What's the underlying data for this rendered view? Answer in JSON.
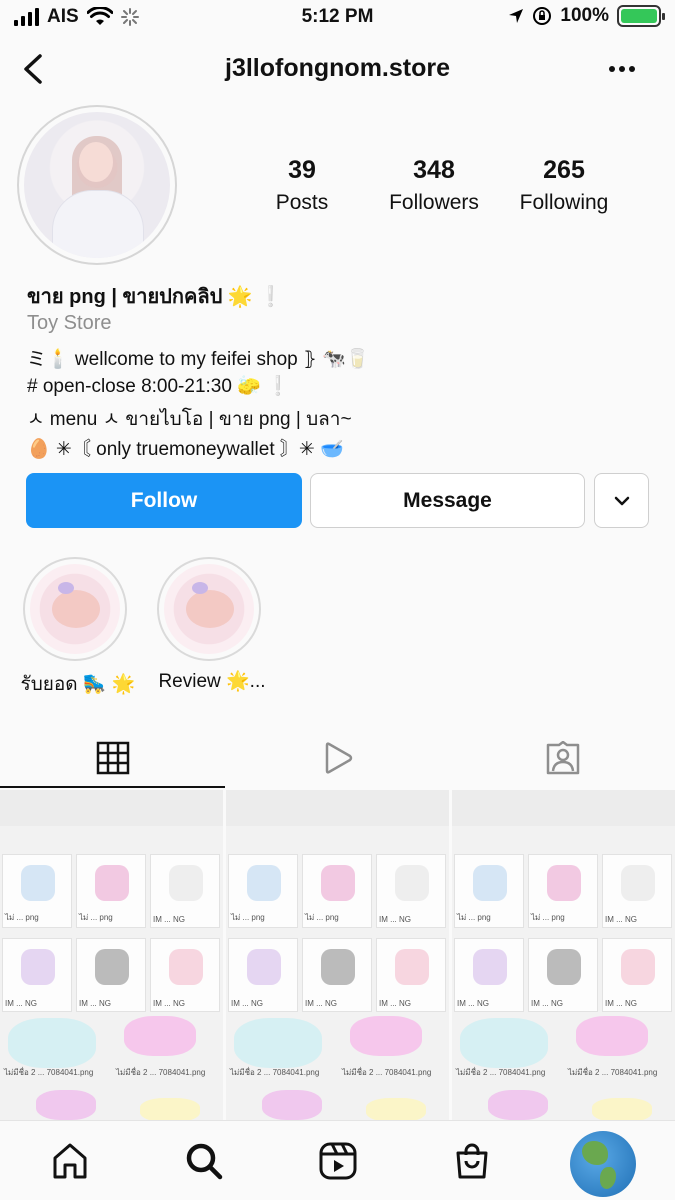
{
  "status_bar": {
    "carrier": "AIS",
    "time": "5:12 PM",
    "battery": "100%",
    "icons": [
      "signal-icon",
      "wifi-icon",
      "loading-icon",
      "location-icon",
      "orientation-lock-icon",
      "battery-charging-icon"
    ]
  },
  "header": {
    "username": "j3llofongnom.store",
    "back_icon": "chevron-left-icon",
    "more_icon": "more-dots-icon"
  },
  "profile": {
    "stats": [
      {
        "value": "39",
        "label": "Posts"
      },
      {
        "value": "348",
        "label": "Followers"
      },
      {
        "value": "265",
        "label": "Following"
      }
    ],
    "name": "ขาย png | ขายปกคลิป 🌟 ❕",
    "category": "Toy Store",
    "bio_lines": [
      "ミ🕯️ wellcome to my feifei shop ⦄ 🐄🥛",
      "# open-close 8:00-21:30 🧽 ❕",
      "ㅅ menu ㅅ ขายไบโอ | ขาย png | บลา~",
      "🥚 ✳︎〘 only truemoneywallet 〙✳︎ 🥣"
    ]
  },
  "actions": {
    "follow": "Follow",
    "message": "Message",
    "dropdown_icon": "chevron-down-icon",
    "follow_color": "#1b94f5"
  },
  "highlights": [
    {
      "label": "รับยอด 🛼 🌟"
    },
    {
      "label": "Review 🌟..."
    }
  ],
  "tabs": [
    {
      "name": "grid-icon",
      "active": true
    },
    {
      "name": "reels-play-icon",
      "active": false
    },
    {
      "name": "tagged-user-icon",
      "active": false
    }
  ],
  "posts": [
    {
      "captions": [
        "ไม่ ... png",
        "ไม่ ... png",
        "IM ... NG",
        "IM ... NG",
        "IM ... NG",
        "IM ... NG",
        "ไม่มีชื่อ 2 ... 7084041.png",
        "ไม่มีชื่อ 2 ... 7084041.png"
      ]
    },
    {
      "captions": [
        "ไม่ ... png",
        "ไม่ ... png",
        "IM ... NG",
        "IM ... NG",
        "IM ... NG",
        "IM ... NG",
        "ไม่มีชื่อ 2 ... 7084041.png",
        "ไม่มีชื่อ 2 ... 7084041.png"
      ]
    },
    {
      "captions": [
        "ไม่ ... png",
        "ไม่ ... png",
        "IM ... NG",
        "IM ... NG",
        "IM ... NG",
        "IM ... NG",
        "ไม่มีชื่อ 2 ... 7084041.png",
        "ไม่มีชื่อ 2 ... 7084041.png"
      ]
    }
  ],
  "bottom_nav": [
    {
      "name": "home-icon"
    },
    {
      "name": "search-icon",
      "active": true
    },
    {
      "name": "reels-icon"
    },
    {
      "name": "shop-icon"
    },
    {
      "name": "profile-globe-icon"
    }
  ]
}
